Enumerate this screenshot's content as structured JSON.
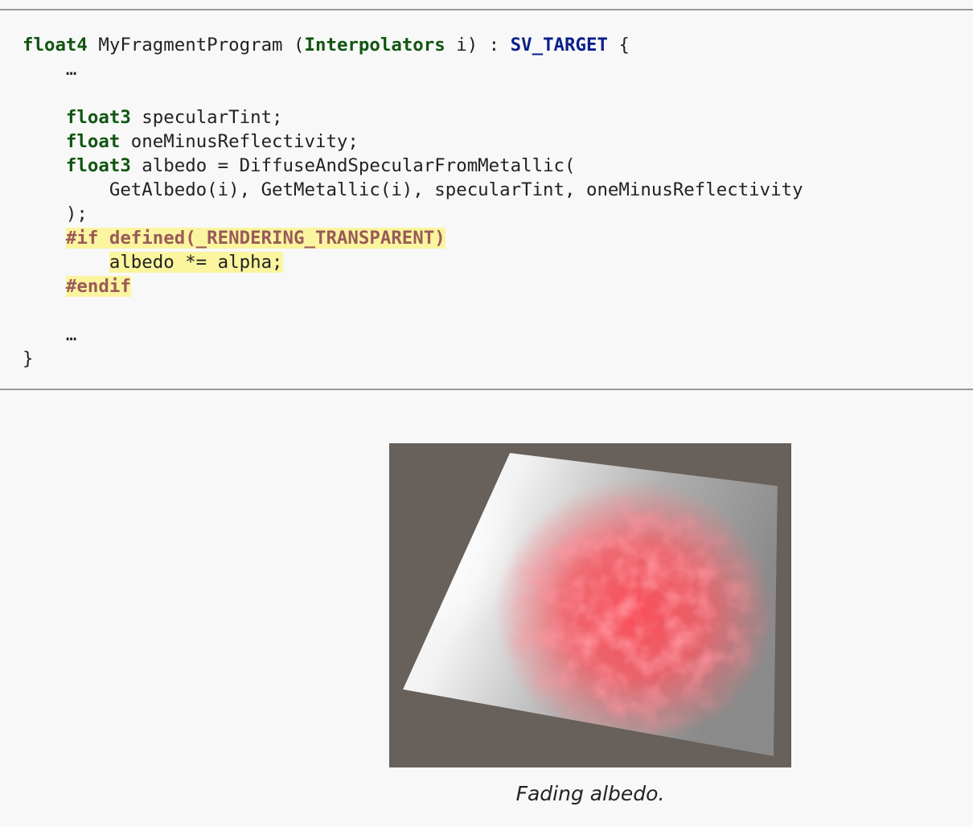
{
  "code": {
    "signature": {
      "return_type": "float4",
      "function_name": " MyFragmentProgram (",
      "param_type": "Interpolators",
      "param_rest": " i) : ",
      "semantic": "SV_TARGET",
      "open_brace": " {"
    },
    "ellipsis_top": "    …",
    "specular_decl": {
      "indent": "    ",
      "type": "float3",
      "rest": " specularTint;"
    },
    "reflectivity_decl": {
      "indent": "    ",
      "type": "float",
      "rest": " oneMinusReflectivity;"
    },
    "albedo_decl": {
      "indent": "    ",
      "type": "float3",
      "rest": " albedo = DiffuseAndSpecularFromMetallic("
    },
    "args_line": "        GetAlbedo(i), GetMetallic(i), specularTint, oneMinusReflectivity",
    "close_paren": "    );",
    "if_directive": {
      "indent": "    ",
      "text": "#if defined(_RENDERING_TRANSPARENT)"
    },
    "alpha_line": {
      "indent": "        ",
      "text": "albedo *= alpha;"
    },
    "endif_directive": {
      "indent": "    ",
      "text": "#endif"
    },
    "ellipsis_bottom": "    …",
    "close_brace": "}"
  },
  "figure": {
    "caption": "Fading albedo.",
    "background_color": "#68605a",
    "tint_color": "#ff4a55"
  }
}
